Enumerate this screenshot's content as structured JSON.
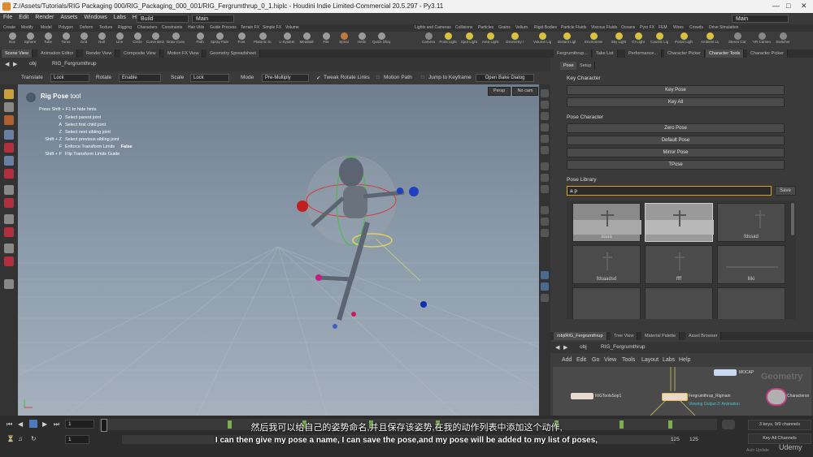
{
  "window": {
    "title": "Z:/Assets/Tutorials/RIG Packaging 000/RIG_Packaging_000_001/RIG_Fergrumthrup_0_1.hiplc - Houdini Indie Limited-Commercial 20.5.297 - Py3.11"
  },
  "menu": [
    "File",
    "Edit",
    "Render",
    "Assets",
    "Windows",
    "Labs",
    "Help"
  ],
  "desktop_left": "Build",
  "desktop_mid": "Main",
  "desktop_right": "Main",
  "shelf_tabs_left": [
    "Create",
    "Modify",
    "Model",
    "Polygon",
    "Deform",
    "Texture",
    "Rigging",
    "Characters",
    "Constraints",
    "Hair Utils",
    "Guide Process",
    "Terrain FX",
    "Simple FX",
    "Volume"
  ],
  "shelf_tabs_right": [
    "Lights and Cameras",
    "Collisions",
    "Particles",
    "Grains",
    "Vellum",
    "Rigid Bodies",
    "Particle Fluids",
    "Viscous Fluids",
    "Oceans",
    "Pyro FX",
    "FEM",
    "Wires",
    "Crowds",
    "Drive Simulation"
  ],
  "tools_left": [
    "Box",
    "Sphere",
    "Tube",
    "Torus",
    "Grid",
    "Null",
    "Line",
    "Circle",
    "Curve Bezier",
    "Draw Curve",
    "Path",
    "Spray Paint",
    "Font",
    "Platonic Solids",
    "L-System",
    "Metaball",
    "File",
    "Spiral",
    "Helix",
    "Quick Shapes"
  ],
  "tools_right": [
    "Camera",
    "Point Light",
    "Spot Light",
    "Area Light",
    "Geometry Light",
    "Volume Light",
    "Distant Light",
    "Environment Light",
    "Sky Light",
    "GI Light",
    "Caustic Light",
    "Portal Light",
    "Ambient Light",
    "Stereo Camera",
    "VR Camera",
    "Switcher"
  ],
  "pane_tabs_left": [
    "Scene View",
    "Animation Editor",
    "Render View",
    "Composite View",
    "Motion FX View",
    "Geometry Spreadsheet"
  ],
  "path": {
    "context": "obj",
    "node": "RIG_Fergrumthrup"
  },
  "opbar": {
    "translate_label": "Translate",
    "translate_val": "Lock",
    "rotate_label": "Rotate",
    "rotate_val": "Enable",
    "scale_label": "Scale",
    "scale_val": "Lock",
    "mode_label": "Mode",
    "mode_val": "Pre-Multiply",
    "tweak": "Tweak Rotate Links",
    "motion": "Motion Path",
    "jump": "Jump to Keyframe",
    "bake": "Open Bake Dialog"
  },
  "viewport": {
    "persp": "Persp",
    "cam": "No cam",
    "tool_name": "Rig Pose",
    "tool_suffix": "tool",
    "hint_hide": "Press Shift + F1 to hide hints",
    "hints": [
      {
        "key": "Q",
        "text": "Select parent joint"
      },
      {
        "key": "A",
        "text": "Select first child joint"
      },
      {
        "key": "Z",
        "text": "Select next sibling joint"
      },
      {
        "key": "Shift + Z",
        "text": "Select previous sibling joint"
      },
      {
        "key": "F",
        "text": "Enforce Transform Limits",
        "value": "False"
      },
      {
        "key": "Shift + F",
        "text": "Flip Transform Limits Guide"
      }
    ]
  },
  "right_tabs": [
    "Fergrumthrup...",
    "Take List",
    "Performance...",
    "Character Picker",
    "Character Tools",
    "Character Picker"
  ],
  "pose_tabs": [
    "Pose",
    "Setup"
  ],
  "key_character": {
    "label": "Key Character",
    "buttons": [
      "Key Pose",
      "Key All"
    ]
  },
  "pose_character": {
    "label": "Pose Character",
    "buttons": [
      "Zero Pose",
      "Default Pose",
      "Mirror Pose",
      "TPose"
    ]
  },
  "pose_library": {
    "label": "Pose Library",
    "input_value": "a p",
    "save": "Save",
    "items": [
      "aaaa",
      "",
      "fdssad",
      "fdsaadsd",
      "ffff",
      "lliki",
      "",
      "",
      ""
    ]
  },
  "network": {
    "tabs": [
      "/obj/RIG_Fergrumthrup",
      "Tree View",
      "Material Palette",
      "Asset Browser"
    ],
    "path_context": "obj",
    "path_node": "RIG_Fergrumthrup",
    "menu": [
      "Add",
      "Edit",
      "Go",
      "View",
      "Tools",
      "Layout",
      "Labs",
      "Help"
    ],
    "watermark": "Geometry",
    "nodes": [
      "MOCAP",
      "RIGToolsSop1",
      "Fergrumthrup_Rigmain",
      "Charactersn"
    ],
    "node_note": "Viewing Output 2: Animation"
  },
  "timeline": {
    "frame": "1",
    "start": "1",
    "end1": "125",
    "end2": "125",
    "keys_info": "3 keys, 9/9 channels",
    "key_all": "Key All Channels",
    "auto_update": "Auto Update"
  },
  "subtitles": {
    "zh": "然后我可以给自己的姿势命名,并且保存该姿势,在我的动作列表中添加这个动作,",
    "en": "I can then give my pose a name, I can save the pose,and my pose will be added to my list of poses,"
  },
  "brand": "Udemy"
}
